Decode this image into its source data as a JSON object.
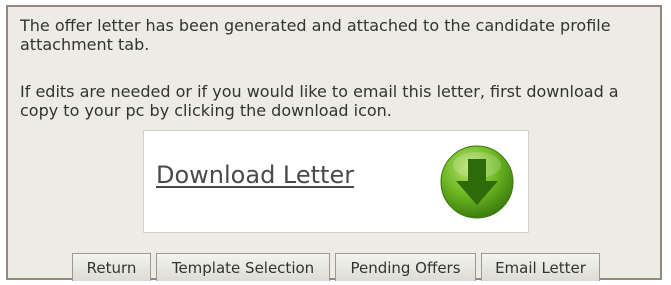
{
  "message": {
    "line1": "The offer letter has been generated and attached to the candidate profile attachment tab.",
    "line2": "If edits are needed or if you would like to email this letter, first download a copy to your pc by clicking the download icon."
  },
  "download": {
    "label": "Download Letter",
    "icon": "download-arrow-icon"
  },
  "buttons": {
    "return": "Return",
    "template_selection": "Template Selection",
    "pending_offers": "Pending Offers",
    "email_letter": "Email Letter"
  },
  "colors": {
    "panel_bg": "#ecebe4",
    "panel_border": "#8f8a7c",
    "icon_green": "#5aa61c"
  }
}
